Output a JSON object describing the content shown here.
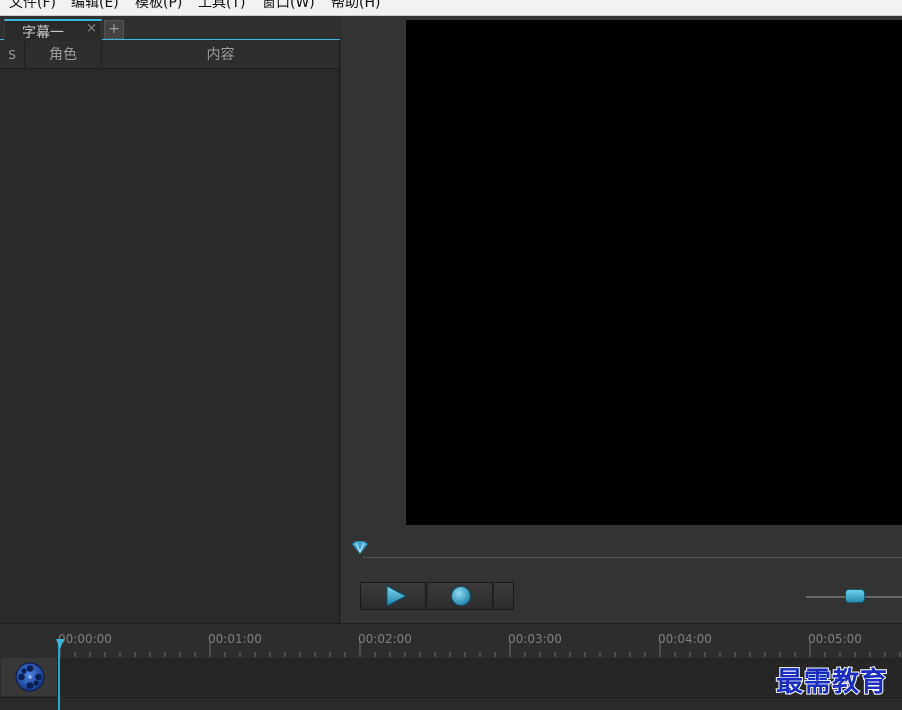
{
  "menu": {
    "items": [
      {
        "label": "文件(F)"
      },
      {
        "label": "编辑(E)"
      },
      {
        "label": "模板(P)"
      },
      {
        "label": "工具(T)"
      },
      {
        "label": "窗口(W)"
      },
      {
        "label": "帮助(H)"
      }
    ]
  },
  "subtitle_panel": {
    "tab_label": "字幕一",
    "tab_close": "×",
    "tab_add": "+",
    "columns": {
      "s": "S",
      "role": "角色",
      "content": "内容"
    }
  },
  "timeline": {
    "timecodes": [
      "00:00:00",
      "00:01:00",
      "00:02:00",
      "00:03:00",
      "00:04:00",
      "00:05:00"
    ]
  },
  "icons": {
    "scrub_handle": "diamond-marker-icon",
    "play": "play-icon",
    "stop": "stop-icon",
    "track": "film-reel-icon"
  },
  "colors": {
    "accent": "#3fb6d8",
    "video_background": "#000000",
    "watermark": "#1a2dbf"
  },
  "watermark": {
    "text": "最需教育"
  }
}
